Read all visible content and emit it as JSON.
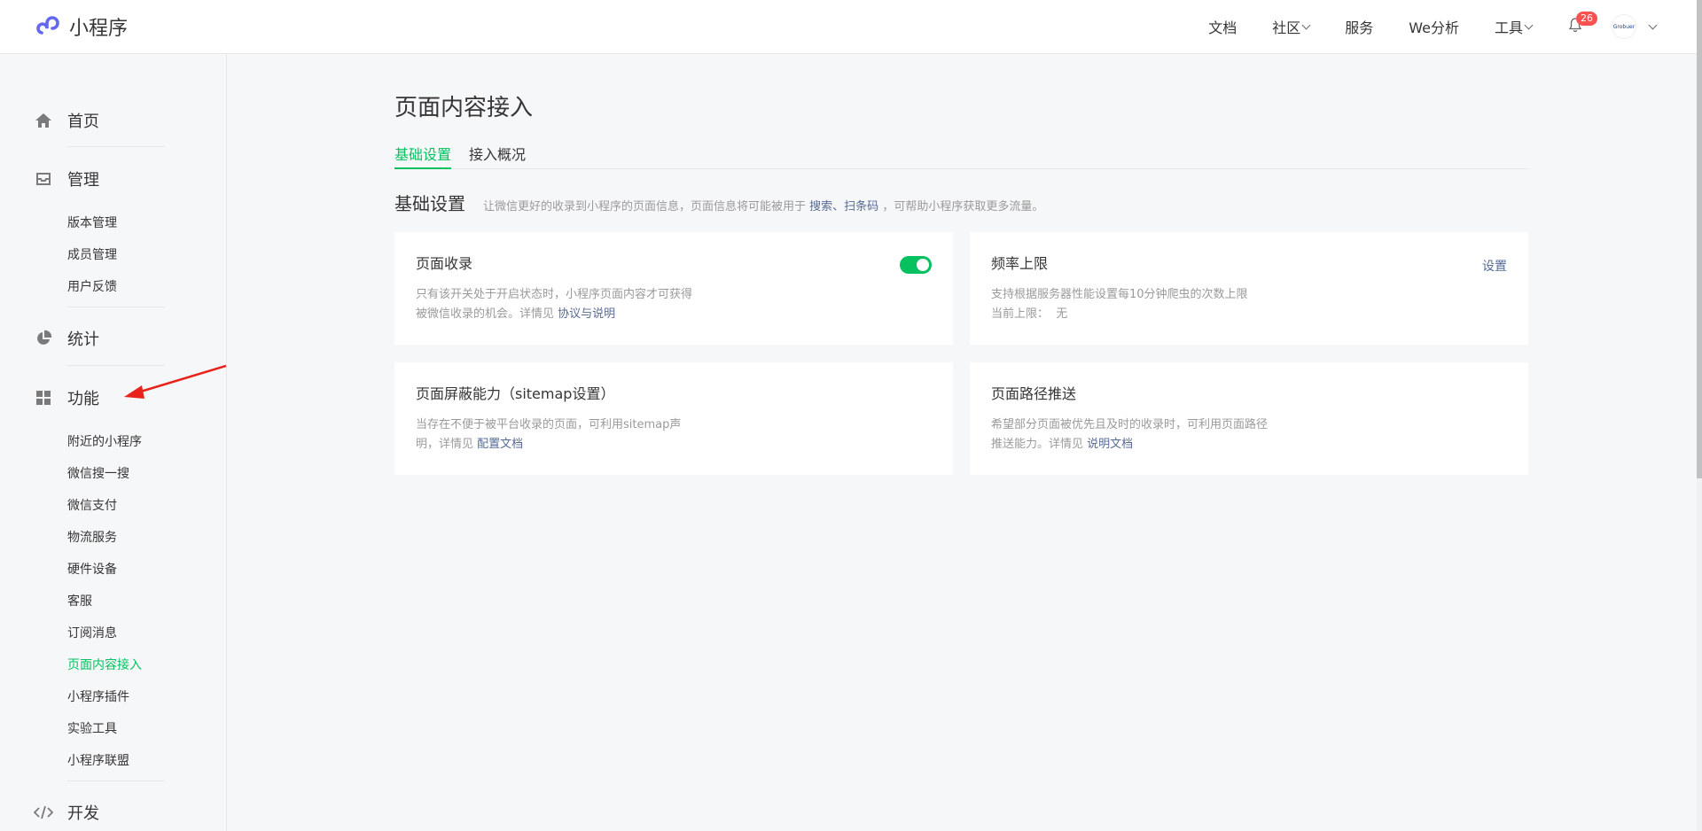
{
  "app": {
    "title": "小程序"
  },
  "topnav": {
    "docs": "文档",
    "community": "社区",
    "services": "服务",
    "we_analytics": "We分析",
    "tools": "工具",
    "notification_count": "26",
    "avatar_text": "Grobuer"
  },
  "sidebar": {
    "home": "首页",
    "manage": "管理",
    "manage_items": [
      "版本管理",
      "成员管理",
      "用户反馈"
    ],
    "stats": "统计",
    "features": "功能",
    "feature_items": [
      "附近的小程序",
      "微信搜一搜",
      "微信支付",
      "物流服务",
      "硬件设备",
      "客服",
      "订阅消息",
      "页面内容接入",
      "小程序插件",
      "实验工具",
      "小程序联盟"
    ],
    "active_item": "页面内容接入",
    "dev": "开发"
  },
  "main": {
    "title": "页面内容接入",
    "tabs": [
      "基础设置",
      "接入概况"
    ],
    "section": {
      "title": "基础设置",
      "desc_prefix": "让微信更好的收录到小程序的页面信息，页面信息将可能被用于",
      "desc_link": "搜索、扫条码",
      "desc_suffix": "，可帮助小程序获取更多流量。"
    },
    "cards": [
      {
        "title": "页面收录",
        "desc_line1": "只有该开关处于开启状态时，小程序页面内容才可获得",
        "desc_line2": "被微信收录的机会。详情见",
        "link": "协议与说明",
        "toggle_on": true
      },
      {
        "title": "频率上限",
        "desc_line1": "支持根据服务器性能设置每10分钟爬虫的次数上限",
        "desc_line2": "当前上限：  无",
        "action": "设置"
      },
      {
        "title": "页面屏蔽能力（sitemap设置）",
        "desc_line1": "当存在不便于被平台收录的页面，可利用sitemap声",
        "desc_line2": "明，详情见",
        "link": "配置文档"
      },
      {
        "title": "页面路径推送",
        "desc_line1": "希望部分页面被优先且及时的收录时，可利用页面路径",
        "desc_line2": "推送能力。详情见",
        "link": "说明文档"
      }
    ]
  },
  "colors": {
    "accent": "#07c160",
    "link": "#576b95",
    "annotation_arrow": "#e8231b"
  }
}
